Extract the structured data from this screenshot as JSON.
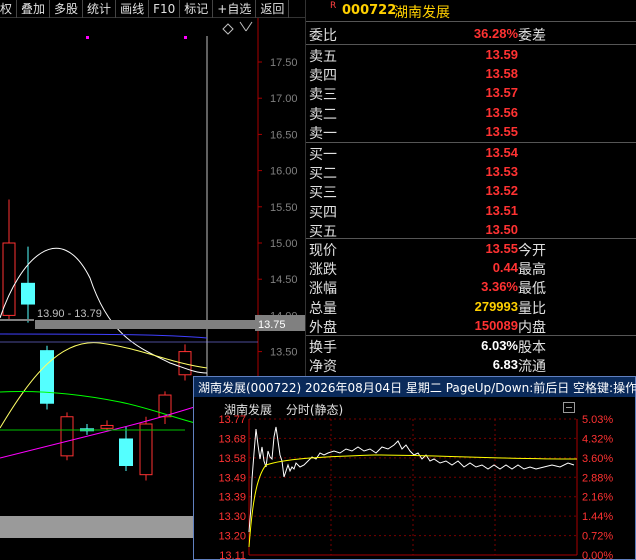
{
  "toolbar": {
    "items": [
      "权",
      "叠加",
      "多股",
      "统计",
      "画线",
      "F10",
      "标记",
      "+自选",
      "返回"
    ]
  },
  "kchart": {
    "price_axis": [
      "17.50",
      "17.00",
      "16.50",
      "16.00",
      "15.50",
      "15.00",
      "14.50",
      "14.00",
      "13.50"
    ],
    "range_label": "13.90 - 13.79",
    "current_price": "13.75",
    "up_color": "#ff3232",
    "down_color": "#54ffff"
  },
  "panel": {
    "r_mark": "R",
    "code": "000722",
    "name": "湖南发展",
    "weibi": {
      "label": "委比",
      "value": "36.28%",
      "label2": "委差"
    },
    "asks": [
      {
        "label": "卖五",
        "price": "13.59"
      },
      {
        "label": "卖四",
        "price": "13.58"
      },
      {
        "label": "卖三",
        "price": "13.57"
      },
      {
        "label": "卖二",
        "price": "13.56"
      },
      {
        "label": "卖一",
        "price": "13.55"
      }
    ],
    "bids": [
      {
        "label": "买一",
        "price": "13.54"
      },
      {
        "label": "买二",
        "price": "13.53"
      },
      {
        "label": "买三",
        "price": "13.52"
      },
      {
        "label": "买四",
        "price": "13.51"
      },
      {
        "label": "买五",
        "price": "13.50"
      }
    ],
    "stats": [
      {
        "label": "现价",
        "value": "13.55",
        "label2": "今开",
        "color": "red"
      },
      {
        "label": "涨跌",
        "value": "0.44",
        "label2": "最高",
        "color": "red"
      },
      {
        "label": "涨幅",
        "value": "3.36%",
        "label2": "最低",
        "color": "red"
      },
      {
        "label": "总量",
        "value": "279993",
        "label2": "量比",
        "color": "yellow"
      },
      {
        "label": "外盘",
        "value": "150089",
        "label2": "内盘",
        "color": "red"
      }
    ],
    "extra": [
      {
        "label": "换手",
        "value": "6.03%",
        "label2": "股本",
        "color": "white"
      },
      {
        "label": "净资",
        "value": "6.83",
        "label2": "流通",
        "color": "white"
      }
    ]
  },
  "popup": {
    "title": "湖南发展(000722) 2026年08月04日 星期二 PageUp/Down:前后日 空格键:操作",
    "mini_name": "湖南发展",
    "mini_mode": "分时(静态)",
    "left_axis": [
      "13.77",
      "13.68",
      "13.58",
      "13.49",
      "13.39",
      "13.30",
      "13.20",
      "13.11"
    ],
    "right_axis": [
      "5.03%",
      "4.32%",
      "3.60%",
      "2.88%",
      "2.16%",
      "1.44%",
      "0.72%",
      "0.00%"
    ]
  }
}
